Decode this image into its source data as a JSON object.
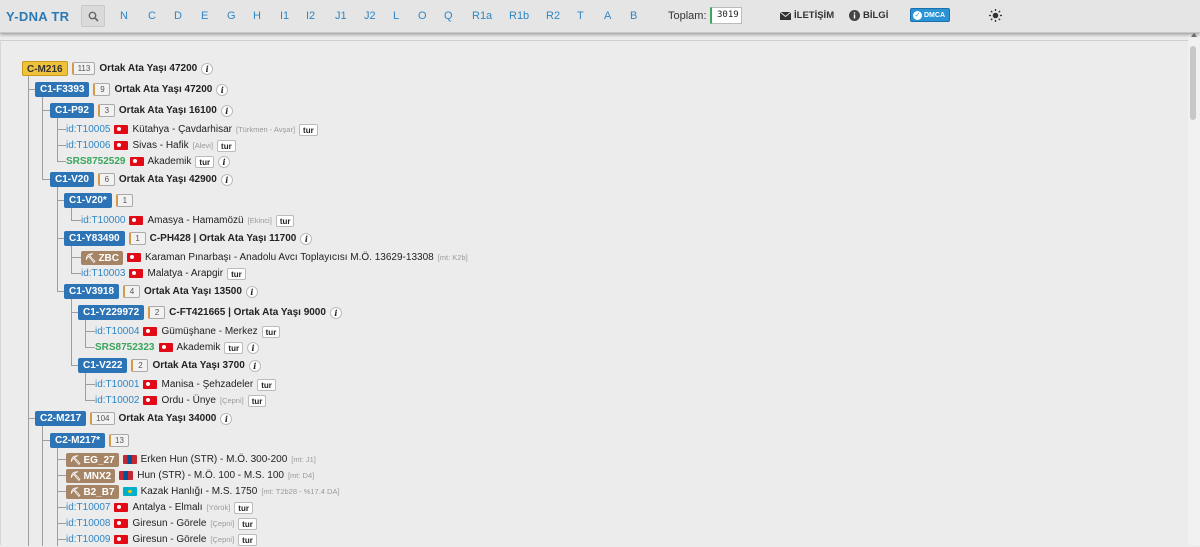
{
  "brand": "Y-DNA TR",
  "haplogroups": [
    "N",
    "C",
    "D",
    "E",
    "G",
    "H",
    "I1",
    "I2",
    "J1",
    "J2",
    "L",
    "O",
    "Q",
    "R1a",
    "R1b",
    "R2",
    "T",
    "A",
    "B"
  ],
  "total": {
    "label": "Toplam:",
    "value": "3019"
  },
  "nav": {
    "contact": "İLETİŞİM",
    "about": "BİLGİ",
    "dmca": "DMCA"
  },
  "tree": [
    {
      "kind": "node",
      "level": 0,
      "name": "C-M216",
      "root": true,
      "count": "113",
      "text": "Ortak Ata Yaşı 47200"
    },
    {
      "kind": "node",
      "level": 1,
      "name": "C1-F3393",
      "count": "9",
      "text": "Ortak Ata Yaşı 47200"
    },
    {
      "kind": "node",
      "level": 2,
      "name": "C1-P92",
      "count": "3",
      "text": "Ortak Ata Yaşı 16100"
    },
    {
      "kind": "sample",
      "level": 3,
      "id": "id:T10005",
      "flag": "tr",
      "place": "Kütahya - Çavdarhisar",
      "note": "[Türkmen - Avşar]",
      "tur": "tur"
    },
    {
      "kind": "sample",
      "level": 3,
      "id": "id:T10006",
      "flag": "tr",
      "place": "Sivas - Hafik",
      "note": "[Alevi]",
      "tur": "tur"
    },
    {
      "kind": "sample",
      "level": 3,
      "id": "SRS8752529",
      "green": true,
      "flag": "tr",
      "place": "Akademik",
      "tur": "tur",
      "info": true
    },
    {
      "kind": "node",
      "level": 2,
      "name": "C1-V20",
      "count": "6",
      "text": "Ortak Ata Yaşı 42900"
    },
    {
      "kind": "node",
      "level": 3,
      "name": "C1-V20*",
      "count": "1"
    },
    {
      "kind": "sample",
      "level": 4,
      "id": "id:T10000",
      "flag": "tr",
      "place": "Amasya - Hamamözü",
      "note": "[Ekinci]",
      "tur": "tur"
    },
    {
      "kind": "node",
      "level": 3,
      "name": "C1-Y83490",
      "count": "1",
      "text": "C-PH428 | Ortak Ata Yaşı 11700"
    },
    {
      "kind": "ancient",
      "level": 4,
      "id": "ZBC",
      "flag": "tr",
      "place": "Karaman Pınarbaşı - Anadolu Avcı Toplayıcısı M.Ö. 13629-13308",
      "note": "[mt: K2b]"
    },
    {
      "kind": "sample",
      "level": 4,
      "id": "id:T10003",
      "flag": "tr",
      "place": "Malatya - Arapgir",
      "tur": "tur"
    },
    {
      "kind": "node",
      "level": 3,
      "name": "C1-V3918",
      "count": "4",
      "text": "Ortak Ata Yaşı 13500"
    },
    {
      "kind": "node",
      "level": 4,
      "name": "C1-Y229972",
      "count": "2",
      "text": "C-FT421665 | Ortak Ata Yaşı 9000"
    },
    {
      "kind": "sample",
      "level": 5,
      "id": "id:T10004",
      "flag": "tr",
      "place": "Gümüşhane - Merkez",
      "tur": "tur"
    },
    {
      "kind": "sample",
      "level": 5,
      "id": "SRS8752323",
      "green": true,
      "flag": "tr",
      "place": "Akademik",
      "tur": "tur",
      "info": true
    },
    {
      "kind": "node",
      "level": 4,
      "name": "C1-V222",
      "count": "2",
      "text": "Ortak Ata Yaşı 3700"
    },
    {
      "kind": "sample",
      "level": 5,
      "id": "id:T10001",
      "flag": "tr",
      "place": "Manisa - Şehzadeler",
      "tur": "tur"
    },
    {
      "kind": "sample",
      "level": 5,
      "id": "id:T10002",
      "flag": "tr",
      "place": "Ordu - Ünye",
      "note": "[Çepni]",
      "tur": "tur"
    },
    {
      "kind": "node",
      "level": 1,
      "name": "C2-M217",
      "count": "104",
      "text": "Ortak Ata Yaşı 34000"
    },
    {
      "kind": "node",
      "level": 2,
      "name": "C2-M217*",
      "count": "13"
    },
    {
      "kind": "ancient",
      "level": 3,
      "id": "EG_27",
      "flag": "mn",
      "place": "Erken Hun (STR) - M.Ö. 300-200",
      "note": "[mt: J1]"
    },
    {
      "kind": "ancient",
      "level": 3,
      "id": "MNX2",
      "flag": "mn",
      "place": "Hun (STR) - M.Ö. 100 - M.S. 100",
      "note": "[mt: D4]"
    },
    {
      "kind": "ancient",
      "level": 3,
      "id": "B2_B7",
      "flag": "kz",
      "place": "Kazak Hanlığı - M.S. 1750",
      "note": "[mt: T2b28 - %17.4 DA]"
    },
    {
      "kind": "sample",
      "level": 3,
      "id": "id:T10007",
      "flag": "tr",
      "place": "Antalya - Elmalı",
      "note": "[Yörük]",
      "tur": "tur"
    },
    {
      "kind": "sample",
      "level": 3,
      "id": "id:T10008",
      "flag": "tr",
      "place": "Giresun - Görele",
      "note": "[Çepni]",
      "tur": "tur"
    },
    {
      "kind": "sample",
      "level": 3,
      "id": "id:T10009",
      "flag": "tr",
      "place": "Giresun - Görele",
      "note": "[Çepni]",
      "tur": "tur"
    }
  ]
}
